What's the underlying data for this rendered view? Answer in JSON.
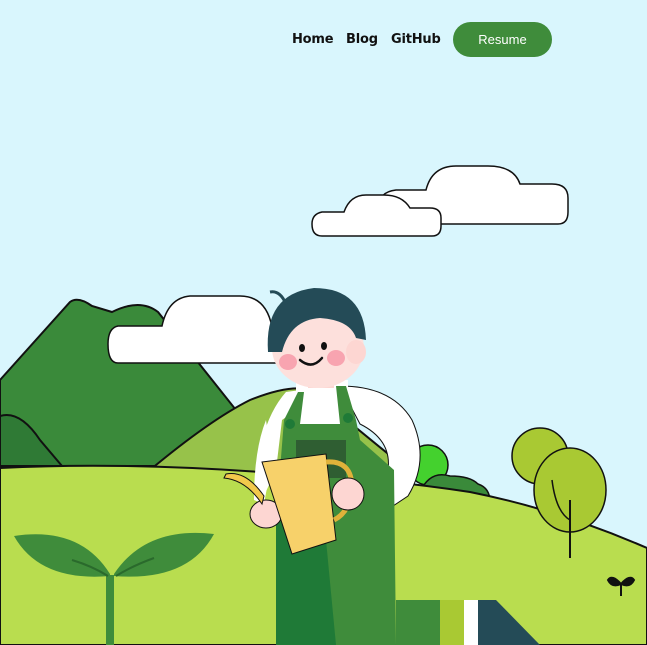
{
  "nav": {
    "links": [
      {
        "label": "Home"
      },
      {
        "label": "Blog"
      },
      {
        "label": "GitHub"
      }
    ],
    "resume_label": "Resume"
  },
  "colors": {
    "sky": "#d9f6fd",
    "accent": "#3f8c3b",
    "hill_light": "#b9dd4f",
    "mountain_dark": "#3a8a3a",
    "tree_yellow_green": "#a9c933"
  },
  "icons": [
    "sprout-icon",
    "leaf-sprout-icon"
  ]
}
